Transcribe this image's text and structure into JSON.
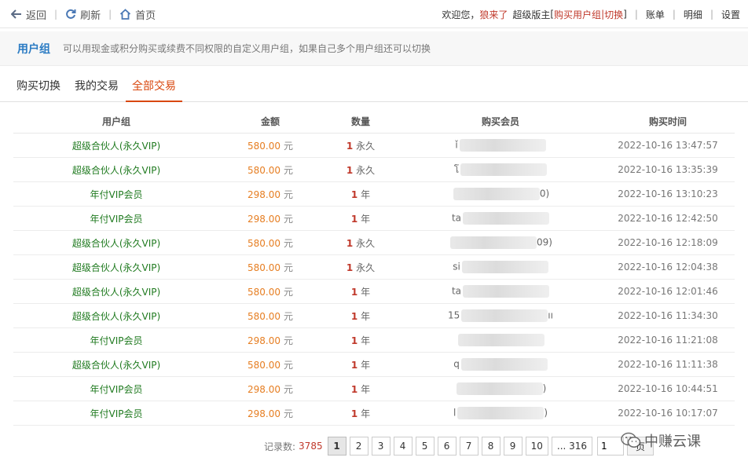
{
  "topnav": {
    "back": "返回",
    "refresh": "刷新",
    "home": "首页",
    "welcome": "欢迎您，",
    "username": "狼来了",
    "role": "超级版主",
    "bracket_open": "[",
    "buy_group": "购买用户组",
    "pipe": "|",
    "switch": "切换",
    "bracket_close": "]",
    "bill": "账单",
    "detail": "明细",
    "settings": "设置"
  },
  "group_header": {
    "title": "用户组",
    "desc": "可以用现金或积分购买或续费不同权限的自定义用户组，如果自己多个用户组还可以切换"
  },
  "tabs": [
    "购买切换",
    "我的交易",
    "全部交易"
  ],
  "table": {
    "headers": [
      "用户组",
      "金额",
      "数量",
      "购买会员",
      "购买时间"
    ],
    "currency": "元",
    "rows": [
      {
        "group": "超级合伙人(永久VIP)",
        "amount": "580.00",
        "qty": "1",
        "qty_unit": "永久",
        "member_pre": "ǐ",
        "member_post": "",
        "time": "2022-10-16 13:47:57"
      },
      {
        "group": "超级合伙人(永久VIP)",
        "amount": "580.00",
        "qty": "1",
        "qty_unit": "永久",
        "member_pre": "โ",
        "member_post": "",
        "time": "2022-10-16 13:35:39"
      },
      {
        "group": "年付VIP会员",
        "amount": "298.00",
        "qty": "1",
        "qty_unit": "年",
        "member_pre": "",
        "member_post": "0)",
        "time": "2022-10-16 13:10:23"
      },
      {
        "group": "年付VIP会员",
        "amount": "298.00",
        "qty": "1",
        "qty_unit": "年",
        "member_pre": "ta",
        "member_post": "",
        "time": "2022-10-16 12:42:50"
      },
      {
        "group": "超级合伙人(永久VIP)",
        "amount": "580.00",
        "qty": "1",
        "qty_unit": "永久",
        "member_pre": "",
        "member_post": "09)",
        "time": "2022-10-16 12:18:09"
      },
      {
        "group": "超级合伙人(永久VIP)",
        "amount": "580.00",
        "qty": "1",
        "qty_unit": "永久",
        "member_pre": "si",
        "member_post": "",
        "time": "2022-10-16 12:04:38"
      },
      {
        "group": "超级合伙人(永久VIP)",
        "amount": "580.00",
        "qty": "1",
        "qty_unit": "年",
        "member_pre": "ta",
        "member_post": "",
        "time": "2022-10-16 12:01:46"
      },
      {
        "group": "超级合伙人(永久VIP)",
        "amount": "580.00",
        "qty": "1",
        "qty_unit": "年",
        "member_pre": "15",
        "member_post": "ıı",
        "time": "2022-10-16 11:34:30"
      },
      {
        "group": "年付VIP会员",
        "amount": "298.00",
        "qty": "1",
        "qty_unit": "年",
        "member_pre": "",
        "member_post": "",
        "time": "2022-10-16 11:21:08"
      },
      {
        "group": "超级合伙人(永久VIP)",
        "amount": "580.00",
        "qty": "1",
        "qty_unit": "年",
        "member_pre": "q",
        "member_post": "",
        "time": "2022-10-16 11:11:38"
      },
      {
        "group": "年付VIP会员",
        "amount": "298.00",
        "qty": "1",
        "qty_unit": "年",
        "member_pre": "",
        "member_post": ")",
        "time": "2022-10-16 10:44:51"
      },
      {
        "group": "年付VIP会员",
        "amount": "298.00",
        "qty": "1",
        "qty_unit": "年",
        "member_pre": "l",
        "member_post": ")",
        "time": "2022-10-16 10:17:07"
      }
    ]
  },
  "pagination": {
    "label": "记录数:",
    "total": "3785",
    "pages": [
      "1",
      "2",
      "3",
      "4",
      "5",
      "6",
      "7",
      "8",
      "9",
      "10",
      "... 316"
    ],
    "current": "1",
    "input_value": "1",
    "go_label": "页"
  },
  "watermark": {
    "text": "中赚云课"
  },
  "colors": {
    "accent": "#d9480f",
    "link_blue": "#2a7bc3",
    "group_green": "#1f7a1f",
    "amount_orange": "#e67e22",
    "qty_red": "#c0392b"
  }
}
